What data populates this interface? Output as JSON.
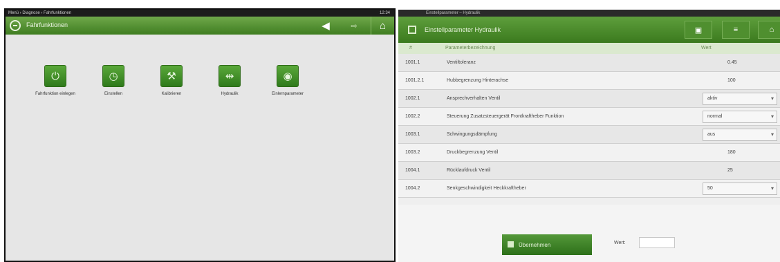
{
  "left": {
    "status_text": "Menü › Diagnose › Fahrfunktionen",
    "status_right": "12:34",
    "title": "Fahrfunktionen",
    "toolbar": {
      "back": "◀",
      "forward": "⇨",
      "home": "⌂"
    },
    "tiles": [
      {
        "label": "Fahrfunktion einlegen",
        "icon": "power-icon",
        "glyph": "⏻"
      },
      {
        "label": "Einstellen",
        "icon": "gauge-icon",
        "glyph": "◷"
      },
      {
        "label": "Kalibrieren",
        "icon": "tool-icon",
        "glyph": "⚒"
      },
      {
        "label": "Hydraulik",
        "icon": "hydraulic-icon",
        "glyph": "⇹"
      },
      {
        "label": "Einlernparameter",
        "icon": "eye-icon",
        "glyph": "◉"
      }
    ]
  },
  "right": {
    "status_text": "Einstellparameter – Hydraulik",
    "title": "Einstellparameter Hydraulik",
    "toolbar": {
      "b1": "▣",
      "b2": "≡",
      "b3": "⌂"
    },
    "table": {
      "col_num": "#",
      "col_name": "Parameterbezeichnung",
      "col_val": "Wert",
      "rows": [
        {
          "id": "1001.1",
          "name": "Ventiltoleranz",
          "value": "0.45"
        },
        {
          "id": "1001.2.1",
          "name": "Hubbegrenzung Hinterachse",
          "value": "100"
        },
        {
          "id": "1002.1",
          "name": "Ansprechverhalten Ventil",
          "select": "aktiv"
        },
        {
          "id": "1002.2",
          "name": "Steuerung Zusatzsteuergerät Frontkraftheber Funktion",
          "select": "normal"
        },
        {
          "id": "1003.1",
          "name": "Schwingungsdämpfung",
          "select": "aus"
        },
        {
          "id": "1003.2",
          "name": "Druckbegrenzung Ventil",
          "value": "180"
        },
        {
          "id": "1004.1",
          "name": "Rücklaufdruck Ventil",
          "value": "25"
        },
        {
          "id": "1004.2",
          "name": "Senkgeschwindigkeit Heckkraftheber",
          "select": "50"
        }
      ]
    },
    "run_button": "Übernehmen",
    "field_label": "Wert:",
    "field_value": ""
  }
}
